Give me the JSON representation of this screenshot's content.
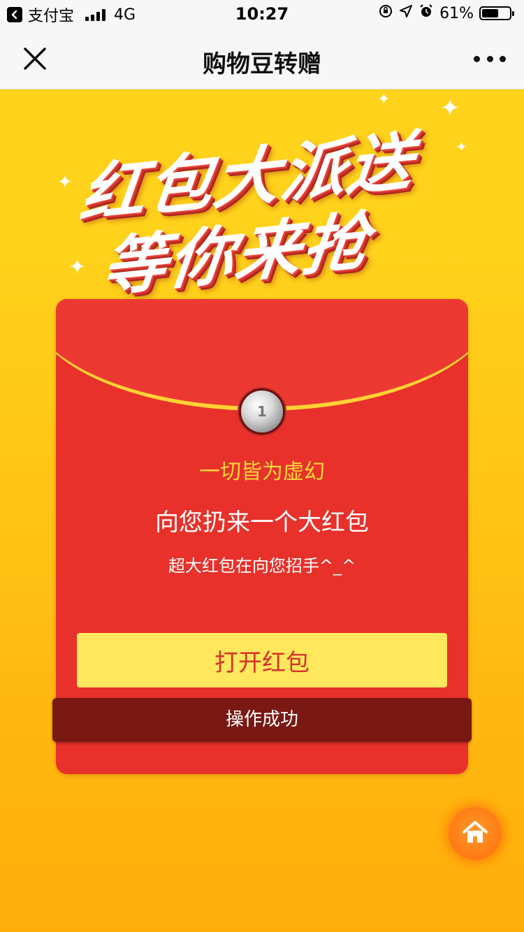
{
  "status_bar": {
    "app_name": "支付宝",
    "network": "4G",
    "time": "10:27",
    "battery": "61%",
    "battery_level": 0.61
  },
  "nav": {
    "title": "购物豆转赠"
  },
  "banner": {
    "line1": "红包大派送",
    "line2": "等你来抢"
  },
  "envelope": {
    "sender_name": "一切皆为虚幻",
    "message": "向您扔来一个大红包",
    "sub_message": "超大红包在向您招手^_^",
    "open_label": "打开红包"
  },
  "toast": {
    "text": "操作成功"
  },
  "colors": {
    "envelope_red": "#e8312b",
    "button_yellow": "#ffe85e",
    "accent_gold": "#ffd83a",
    "background_yellow": "#ffd21a",
    "toast_bg": "#7a1814",
    "home_orange": "#ff7a12"
  },
  "icons": {
    "back_app": "chevron-left-icon",
    "close": "close-icon",
    "more": "more-dots-icon",
    "home": "home-icon",
    "location": "location-arrow-icon",
    "alarm": "alarm-icon",
    "rotation_lock": "rotation-lock-icon"
  }
}
